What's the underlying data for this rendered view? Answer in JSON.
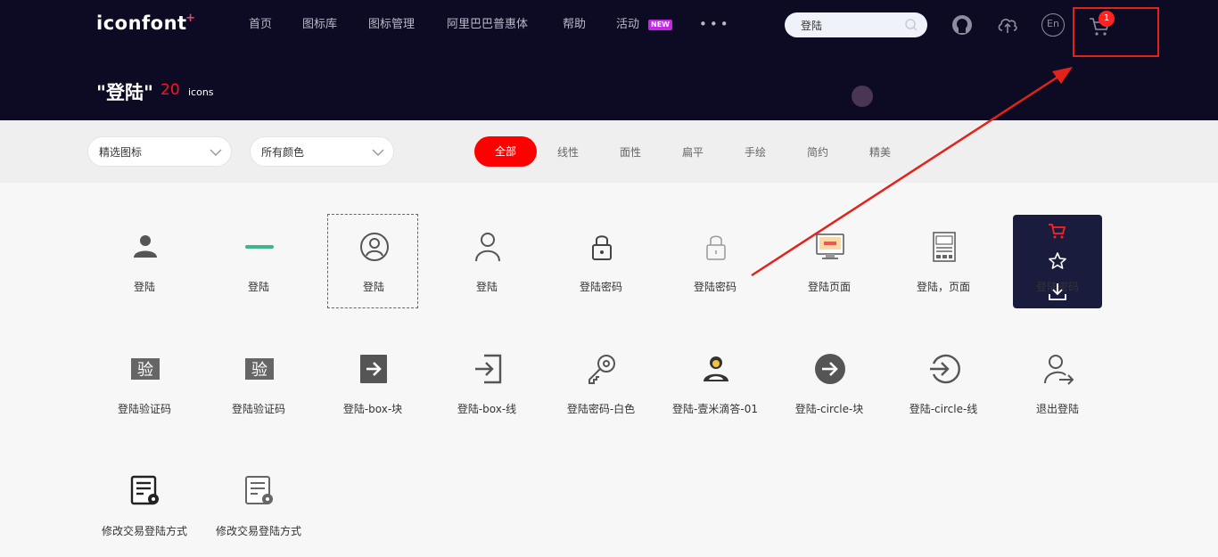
{
  "header": {
    "logo": "iconfont",
    "nav": [
      "首页",
      "图标库",
      "图标管理",
      "阿里巴巴普惠体",
      "帮助",
      "活动"
    ],
    "new_badge": "NEW",
    "more": "•••",
    "search_value": "登陆",
    "cart_count": "1",
    "icons": [
      "github-icon",
      "upload-cloud-icon",
      "language-en-icon",
      "cart-icon"
    ],
    "lang": "En"
  },
  "query": {
    "title": "\"登陆\"",
    "count": "20",
    "unit": "icons"
  },
  "filters": {
    "select1": "精选图标",
    "select2": "所有颜色",
    "tabs": [
      "全部",
      "线性",
      "面性",
      "扁平",
      "手绘",
      "简约",
      "精美"
    ],
    "active_tab": "全部"
  },
  "icons": [
    {
      "label": "登陆"
    },
    {
      "label": "登陆"
    },
    {
      "label": "登陆"
    },
    {
      "label": "登陆"
    },
    {
      "label": "登陆密码"
    },
    {
      "label": "登陆密码"
    },
    {
      "label": "登陆页面"
    },
    {
      "label": "登陆，页面"
    },
    {
      "label": "登陆密码"
    },
    {
      "label": "登陆验证码"
    },
    {
      "label": "登陆验证码"
    },
    {
      "label": "登陆-box-块"
    },
    {
      "label": "登陆-box-线"
    },
    {
      "label": "登陆密码-白色"
    },
    {
      "label": "登陆-壹米滴答-01"
    },
    {
      "label": "登陆-circle-块"
    },
    {
      "label": "登陆-circle-线"
    },
    {
      "label": "退出登陆"
    },
    {
      "label": "修改交易登陆方式"
    },
    {
      "label": "修改交易登陆方式"
    }
  ],
  "colors": {
    "accent": "#ff0000",
    "header_bg": "#0d0b23",
    "annotation": "#e2231a"
  }
}
